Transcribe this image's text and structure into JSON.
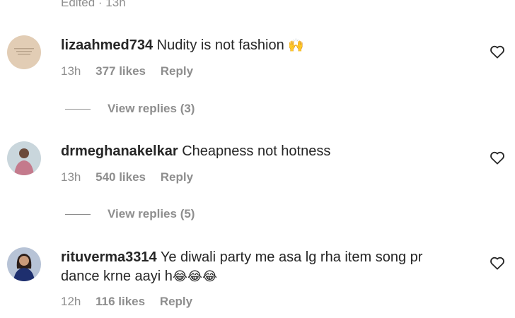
{
  "top_meta": "Edited · 13h",
  "comments": [
    {
      "username": "lizaahmed734",
      "text": "Nudity is not fashion",
      "emoji": "🙌",
      "time": "13h",
      "likes": "377 likes",
      "reply": "Reply",
      "view_replies": "View replies (3)"
    },
    {
      "username": "drmeghanakelkar",
      "text": "Cheapness not hotness",
      "emoji": "",
      "time": "13h",
      "likes": "540 likes",
      "reply": "Reply",
      "view_replies": "View replies (5)"
    },
    {
      "username": "rituverma3314",
      "text": "Ye diwali party me asa lg rha item song pr dance krne aayi h",
      "emoji": "😂😂😂",
      "time": "12h",
      "likes": "116 likes",
      "reply": "Reply"
    }
  ],
  "colors": {
    "text": "#262626",
    "muted": "#8e8e8e"
  }
}
